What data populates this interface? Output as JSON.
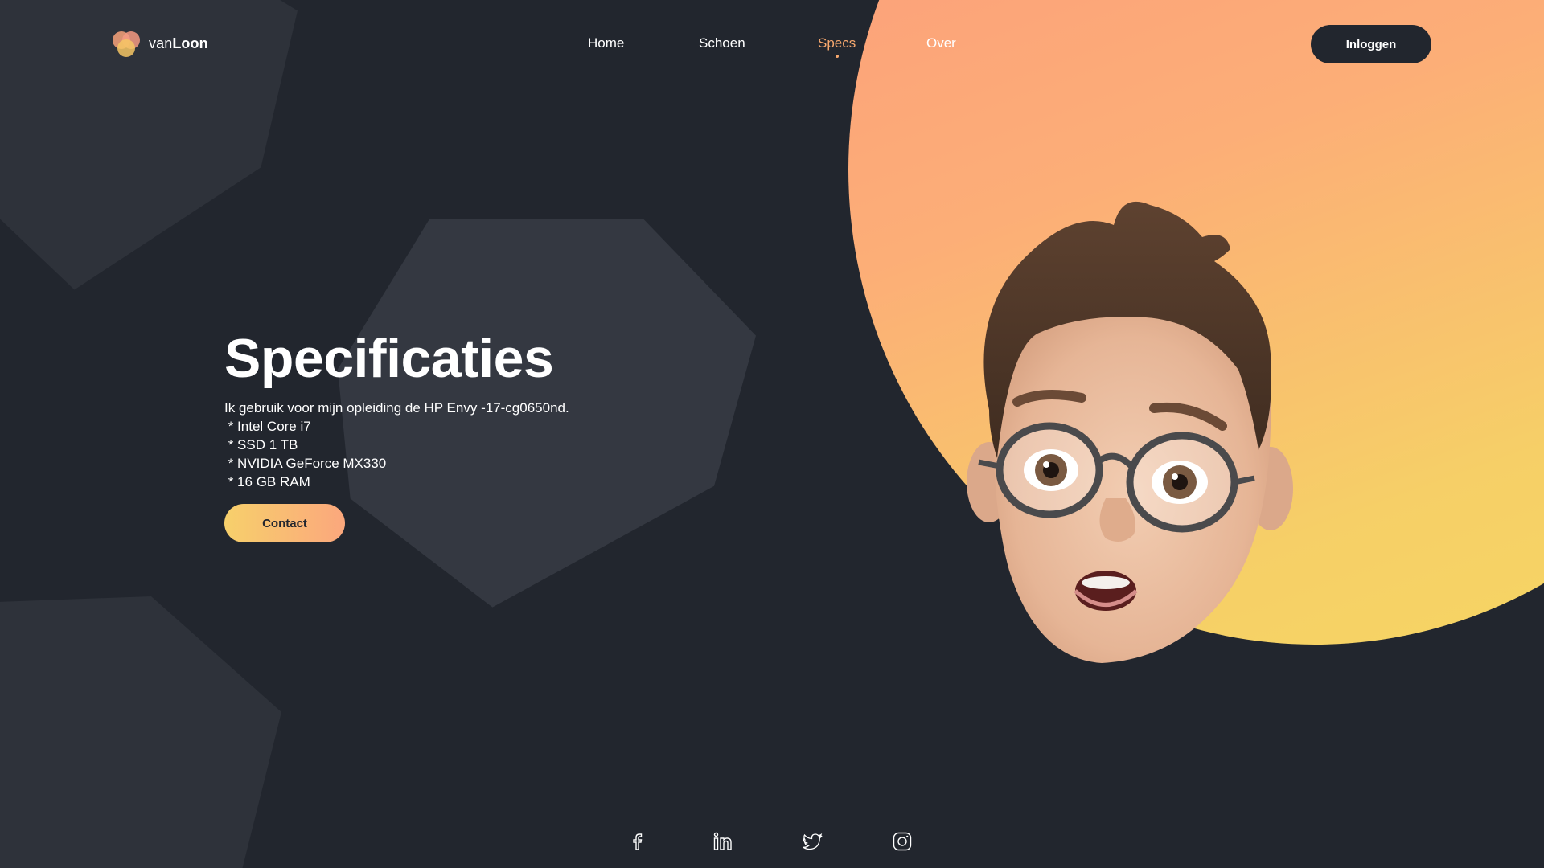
{
  "brand": {
    "prefix": "van",
    "name": "Loon"
  },
  "nav": {
    "items": [
      {
        "label": "Home",
        "active": false
      },
      {
        "label": "Schoen",
        "active": false
      },
      {
        "label": "Specs",
        "active": true
      },
      {
        "label": "Over",
        "active": false
      }
    ],
    "login_label": "Inloggen"
  },
  "hero": {
    "title": "Specificaties",
    "intro": "Ik gebruik voor mijn opleiding de HP Envy -17-cg0650nd.",
    "specs": [
      " * Intel Core i7",
      " * SSD 1 TB",
      " * NVIDIA GeForce MX330",
      " * 16 GB RAM"
    ],
    "contact_label": "Contact"
  },
  "avatar": {
    "icon": "memoji-avatar"
  },
  "socials": [
    {
      "icon": "facebook-icon"
    },
    {
      "icon": "linkedin-icon"
    },
    {
      "icon": "twitter-icon"
    },
    {
      "icon": "instagram-icon"
    }
  ],
  "colors": {
    "background": "#22262e",
    "shape": "#2e323a",
    "accent": "#f7a86e",
    "gradient_start": "#f7d06b",
    "gradient_end": "#fba77d"
  }
}
